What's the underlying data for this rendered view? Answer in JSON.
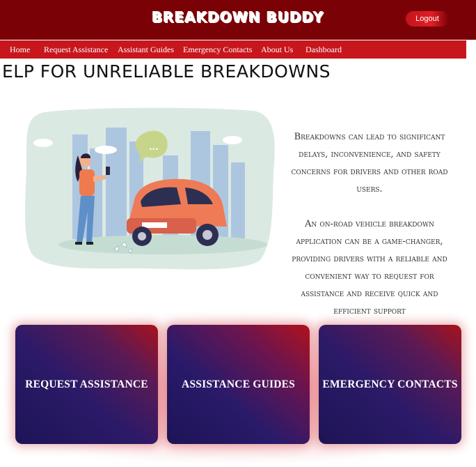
{
  "header": {
    "brand": "BREAKDOWN BUDDY",
    "logout_label": "Logout"
  },
  "nav": {
    "items": [
      {
        "label": "Home"
      },
      {
        "label": "Request Assistance"
      },
      {
        "label": "Assistant Guides"
      },
      {
        "label": "Emergency Contacts"
      },
      {
        "label": "About Us"
      },
      {
        "label": "Dashboard"
      }
    ]
  },
  "main": {
    "heading": "ELP FOR UNRELIABLE BREAKDOWNS",
    "paragraphs": [
      "Breakdowns can lead to significant delays, inconvenience, and safety concerns for drivers and other road users.",
      "An on-road vehicle breakdown application can be a game-changer, providing drivers with a reliable and convenient way to request for assistance and receive quick and efficient support"
    ],
    "illustration_bubble": "..."
  },
  "cards": [
    {
      "label": "REQUEST ASSISTANCE"
    },
    {
      "label": "ASSISTANCE GUIDES"
    },
    {
      "label": "EMERGENCY CONTACTS"
    }
  ],
  "colors": {
    "header_bg": "#7a0207",
    "nav_bg": "#c8161d",
    "card_dark": "#1d1456",
    "card_red": "#a8121c"
  }
}
